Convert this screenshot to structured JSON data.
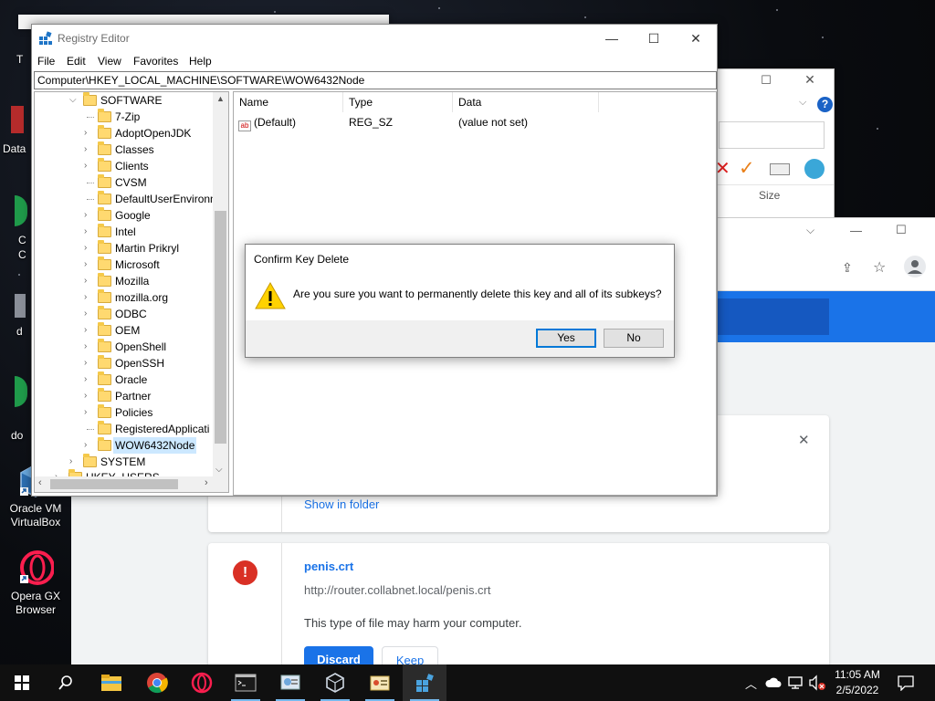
{
  "desktop": {
    "icons": [
      {
        "label": "Oracle VM VirtualBox"
      },
      {
        "label": "Opera GX Browser"
      }
    ],
    "partial_labels": [
      "T",
      "Data",
      "C",
      "C",
      "d",
      "do"
    ]
  },
  "background_window": {
    "size_header": "Size",
    "help_glyph": "?"
  },
  "download_page": {
    "show_in_folder": "Show in folder",
    "warning_item": {
      "filename": "penis.crt",
      "url": "http://router.collabnet.local/penis.crt",
      "warning": "This type of file may harm your computer.",
      "discard": "Discard",
      "keep": "Keep"
    },
    "close_glyph": "✕"
  },
  "regedit": {
    "title": "Registry Editor",
    "menu": [
      "File",
      "Edit",
      "View",
      "Favorites",
      "Help"
    ],
    "address": "Computer\\HKEY_LOCAL_MACHINE\\SOFTWARE\\WOW6432Node",
    "tree": {
      "root": "SOFTWARE",
      "children": [
        "7-Zip",
        "AdoptOpenJDK",
        "Classes",
        "Clients",
        "CVSM",
        "DefaultUserEnvironn",
        "Google",
        "Intel",
        "Martin Prikryl",
        "Microsoft",
        "Mozilla",
        "mozilla.org",
        "ODBC",
        "OEM",
        "OpenShell",
        "OpenSSH",
        "Oracle",
        "Partner",
        "Policies",
        "RegisteredApplicati",
        "WOW6432Node"
      ],
      "selected": "WOW6432Node",
      "after": [
        "SYSTEM",
        "HKEY_USERS"
      ]
    },
    "columns": [
      "Name",
      "Type",
      "Data"
    ],
    "values": [
      {
        "name": "(Default)",
        "type": "REG_SZ",
        "data": "(value not set)"
      }
    ]
  },
  "dialog": {
    "title": "Confirm Key Delete",
    "message": "Are you sure you want to permanently delete this key and all of its subkeys?",
    "yes": "Yes",
    "no": "No"
  },
  "taskbar": {
    "time": "11:05 AM",
    "date": "2/5/2022",
    "apps": [
      "start",
      "search",
      "file-explorer",
      "chrome",
      "opera",
      "command-prompt",
      "control-panel",
      "virtualbox",
      "regedit-tool",
      "network-tool"
    ]
  },
  "colors": {
    "accent": "#0078d7",
    "chrome_blue": "#1a73e8",
    "danger": "#d93025"
  }
}
